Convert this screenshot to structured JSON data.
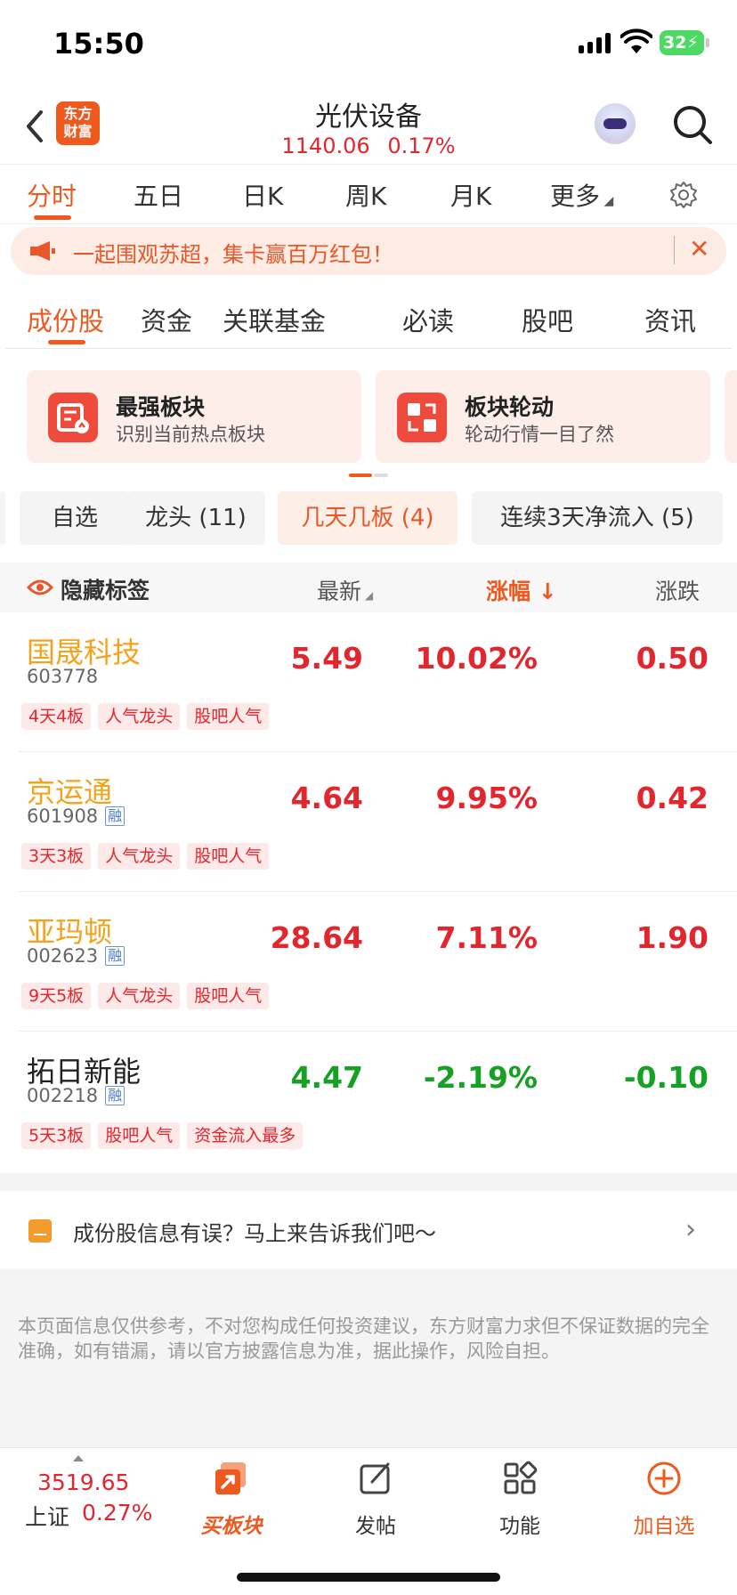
{
  "status_bar": {
    "time": "15:50",
    "battery": "32"
  },
  "header": {
    "title": "光伏设备",
    "index_value": "1140.06",
    "index_change": "0.17%",
    "logo_text": "东方财富"
  },
  "chart_tabs": [
    "分时",
    "五日",
    "日K",
    "周K",
    "月K",
    "更多"
  ],
  "banner": {
    "text": "一起围观苏超，集卡赢百万红包！",
    "close": "✕"
  },
  "section_tabs": [
    "成份股",
    "资金",
    "关联基金",
    "必读",
    "股吧",
    "资讯"
  ],
  "cards": [
    {
      "title": "最强板块",
      "subtitle": "识别当前热点板块"
    },
    {
      "title": "板块轮动",
      "subtitle": "轮动行情一目了然"
    }
  ],
  "filters": [
    "自选",
    "龙头 (11)",
    "几天几板 (4)",
    "连续3天净流入 (5)"
  ],
  "table_header": {
    "hide_tags": "隐藏标签",
    "col_latest": "最新",
    "col_pct": "涨幅",
    "col_change": "涨跌"
  },
  "stocks": [
    {
      "name": "国晟科技",
      "code": "603778",
      "margin": "",
      "price": "5.49",
      "pct": "10.02%",
      "change": "0.50",
      "tags": [
        "4天4板",
        "人气龙头",
        "股吧人气"
      ]
    },
    {
      "name": "京运通",
      "code": "601908",
      "margin": "融",
      "price": "4.64",
      "pct": "9.95%",
      "change": "0.42",
      "tags": [
        "3天3板",
        "人气龙头",
        "股吧人气"
      ]
    },
    {
      "name": "亚玛顿",
      "code": "002623",
      "margin": "融",
      "price": "28.64",
      "pct": "7.11%",
      "change": "1.90",
      "tags": [
        "9天5板",
        "人气龙头",
        "股吧人气"
      ]
    },
    {
      "name": "拓日新能",
      "code": "002218",
      "margin": "融",
      "price": "4.47",
      "pct": "-2.19%",
      "change": "-0.10",
      "tags": [
        "5天3板",
        "股吧人气",
        "资金流入最多"
      ]
    }
  ],
  "feedback": {
    "text": "成份股信息有误？马上来告诉我们吧～"
  },
  "disclaimer": "本页面信息仅供参考，不对您构成任何投资建议，东方财富力求但不保证数据的完全准确，如有错漏，请以官方披露信息为准，据此操作，风险自担。",
  "bottom_nav": {
    "index_value": "3519.65",
    "index_name": "上证",
    "index_pct": "0.27%",
    "buy_label": "买板块",
    "post_label": "发帖",
    "func_label": "功能",
    "add_label": "加自选"
  },
  "colors": {
    "accent": "#f0591e",
    "up": "#e2262e",
    "down": "#16a024",
    "hot_name": "#f4a21b"
  }
}
